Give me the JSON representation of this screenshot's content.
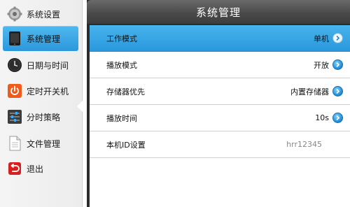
{
  "sidebar": {
    "items": [
      {
        "label": "系统设置",
        "icon": "gear-icon",
        "active": false
      },
      {
        "label": "系统管理",
        "icon": "tablet-icon",
        "active": true
      },
      {
        "label": "日期与时间",
        "icon": "clock-icon",
        "active": false
      },
      {
        "label": "定时开关机",
        "icon": "power-icon",
        "active": false
      },
      {
        "label": "分时策略",
        "icon": "sliders-icon",
        "active": false
      },
      {
        "label": "文件管理",
        "icon": "document-icon",
        "active": false
      },
      {
        "label": "退出",
        "icon": "exit-icon",
        "active": false
      }
    ]
  },
  "panel": {
    "title": "系统管理",
    "rows": [
      {
        "label": "工作模式",
        "value": "单机",
        "has_arrow": true,
        "active": true
      },
      {
        "label": "播放模式",
        "value": "开放",
        "has_arrow": true,
        "active": false
      },
      {
        "label": "存储器优先",
        "value": "内置存储器",
        "has_arrow": true,
        "active": false
      },
      {
        "label": "播放时间",
        "value": "10s",
        "has_arrow": true,
        "active": false
      },
      {
        "label": "本机ID设置",
        "value": "hrr12345",
        "has_arrow": false,
        "active": false
      }
    ]
  },
  "colors": {
    "accent": "#2c98dc",
    "title_bar": "#4a4a4a",
    "power_icon": "#f05a1a",
    "exit_icon": "#d62020"
  }
}
